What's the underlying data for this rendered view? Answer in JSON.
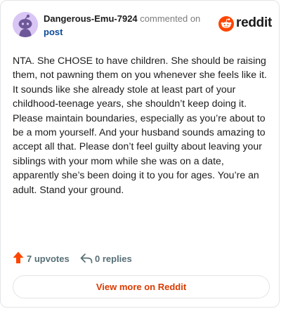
{
  "comment": {
    "author": "Dangerous-Emu-7924",
    "action_text": "commented on",
    "post_link_label": "post",
    "body": "NTA. She CHOSE to have children. She should be raising them, not pawning them on you whenever she feels like it. It sounds like she already stole at least part of your childhood-teenage years, she shouldn’t keep doing it. Please maintain boundaries, especially as you’re about to be a mom yourself. And your husband sounds amazing to accept all that. Please don’t feel guilty about leaving your siblings with your mom while she was on a date, apparently she’s been doing it to you for ages. You’re an adult. Stand your ground.",
    "upvotes_label": "7 upvotes",
    "replies_label": "0 replies"
  },
  "brand": {
    "name": "reddit",
    "icon": "reddit-logo-icon",
    "color": "#ff4500"
  },
  "avatar": {
    "icon": "snoo-avatar-icon",
    "background": "#d9c6f5"
  },
  "icons": {
    "upvote": "upvote-arrow-icon",
    "reply": "reply-arrow-icon"
  },
  "cta": {
    "label": "View more on Reddit",
    "color": "#d93a00"
  },
  "colors": {
    "upvote": "#ff4500",
    "link": "#0b4a94",
    "muted": "#7c7c7c"
  }
}
